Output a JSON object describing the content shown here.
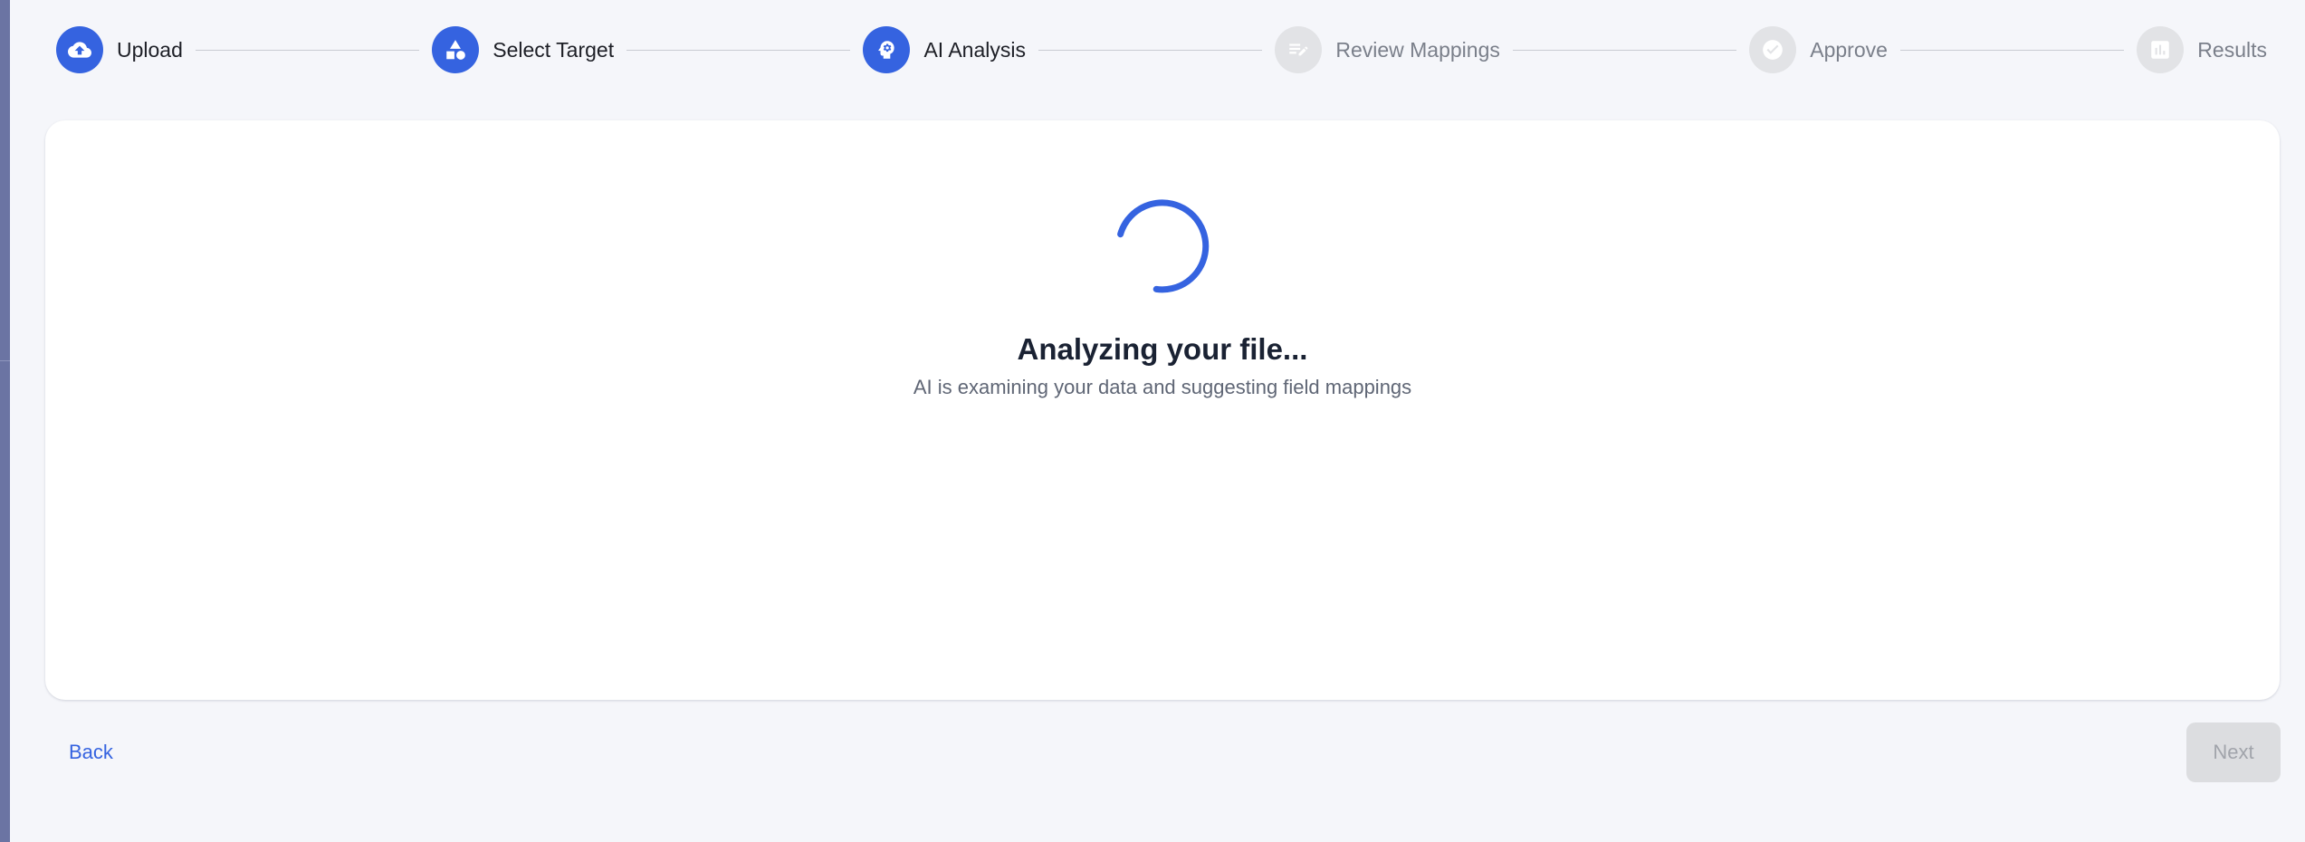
{
  "stepper": {
    "steps": [
      {
        "label": "Upload",
        "icon": "cloud-upload-icon",
        "state": "completed"
      },
      {
        "label": "Select Target",
        "icon": "shapes-icon",
        "state": "completed"
      },
      {
        "label": "AI Analysis",
        "icon": "ai-brain-icon",
        "state": "active"
      },
      {
        "label": "Review Mappings",
        "icon": "edit-list-icon",
        "state": "pending"
      },
      {
        "label": "Approve",
        "icon": "check-circle-icon",
        "state": "pending"
      },
      {
        "label": "Results",
        "icon": "bar-chart-icon",
        "state": "pending"
      }
    ]
  },
  "main": {
    "title": "Analyzing your file...",
    "subtitle": "AI is examining your data and suggesting field mappings"
  },
  "footer": {
    "back_label": "Back",
    "next_label": "Next"
  },
  "colors": {
    "accent": "#3563e0",
    "inactive_step": "#e2e3e6",
    "background": "#f5f6fa"
  }
}
